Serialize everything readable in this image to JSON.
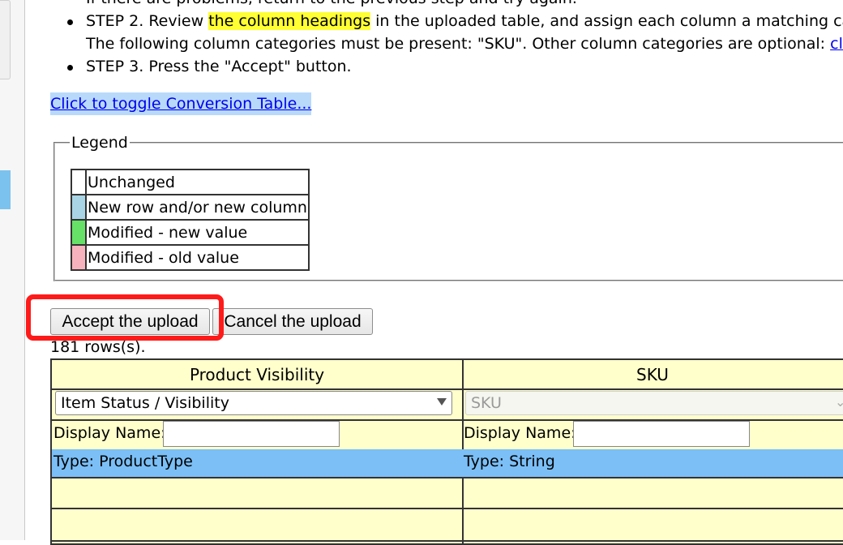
{
  "instructions": {
    "step1_fragment": "If there are problems, return to the previous step and try again.",
    "step2_prefix": "STEP 2. Review ",
    "step2_highlight": "the column headings",
    "step2_suffix": " in the uploaded table, and assign each column a matching cat",
    "step2_line2": "The following column categories must be present: \"SKU\". Other column categories are optional: ",
    "step2_link": "clic",
    "step3": "STEP 3. Press the \"Accept\" button."
  },
  "toggle_link": "Click to toggle Conversion Table...",
  "legend": {
    "title": "Legend",
    "items": [
      {
        "label": "Unchanged",
        "color": "#ffffff"
      },
      {
        "label": "New row and/or new column",
        "color": "#a8d4e6"
      },
      {
        "label": "Modified - new value",
        "color": "#66e066"
      },
      {
        "label": "Modified - old value",
        "color": "#f7b3bd"
      }
    ]
  },
  "buttons": {
    "accept": "Accept the upload",
    "cancel": "Cancel the upload"
  },
  "rows_count": "181 rows(s).",
  "columns": [
    {
      "header": "Product Visibility",
      "select_value": "Item Status / Visibility",
      "display_name_label": "Display Name:",
      "display_name_value": "",
      "type": "Type: ProductType"
    },
    {
      "header": "SKU",
      "select_value": "SKU",
      "display_name_label": "Display Name:",
      "display_name_value": "",
      "type": "Type: String"
    }
  ],
  "colors": {
    "annotation": "#ff1a1a",
    "highlight": "#ffff33",
    "table_bg": "#ffffcc",
    "type_row": "#7bbff6"
  }
}
